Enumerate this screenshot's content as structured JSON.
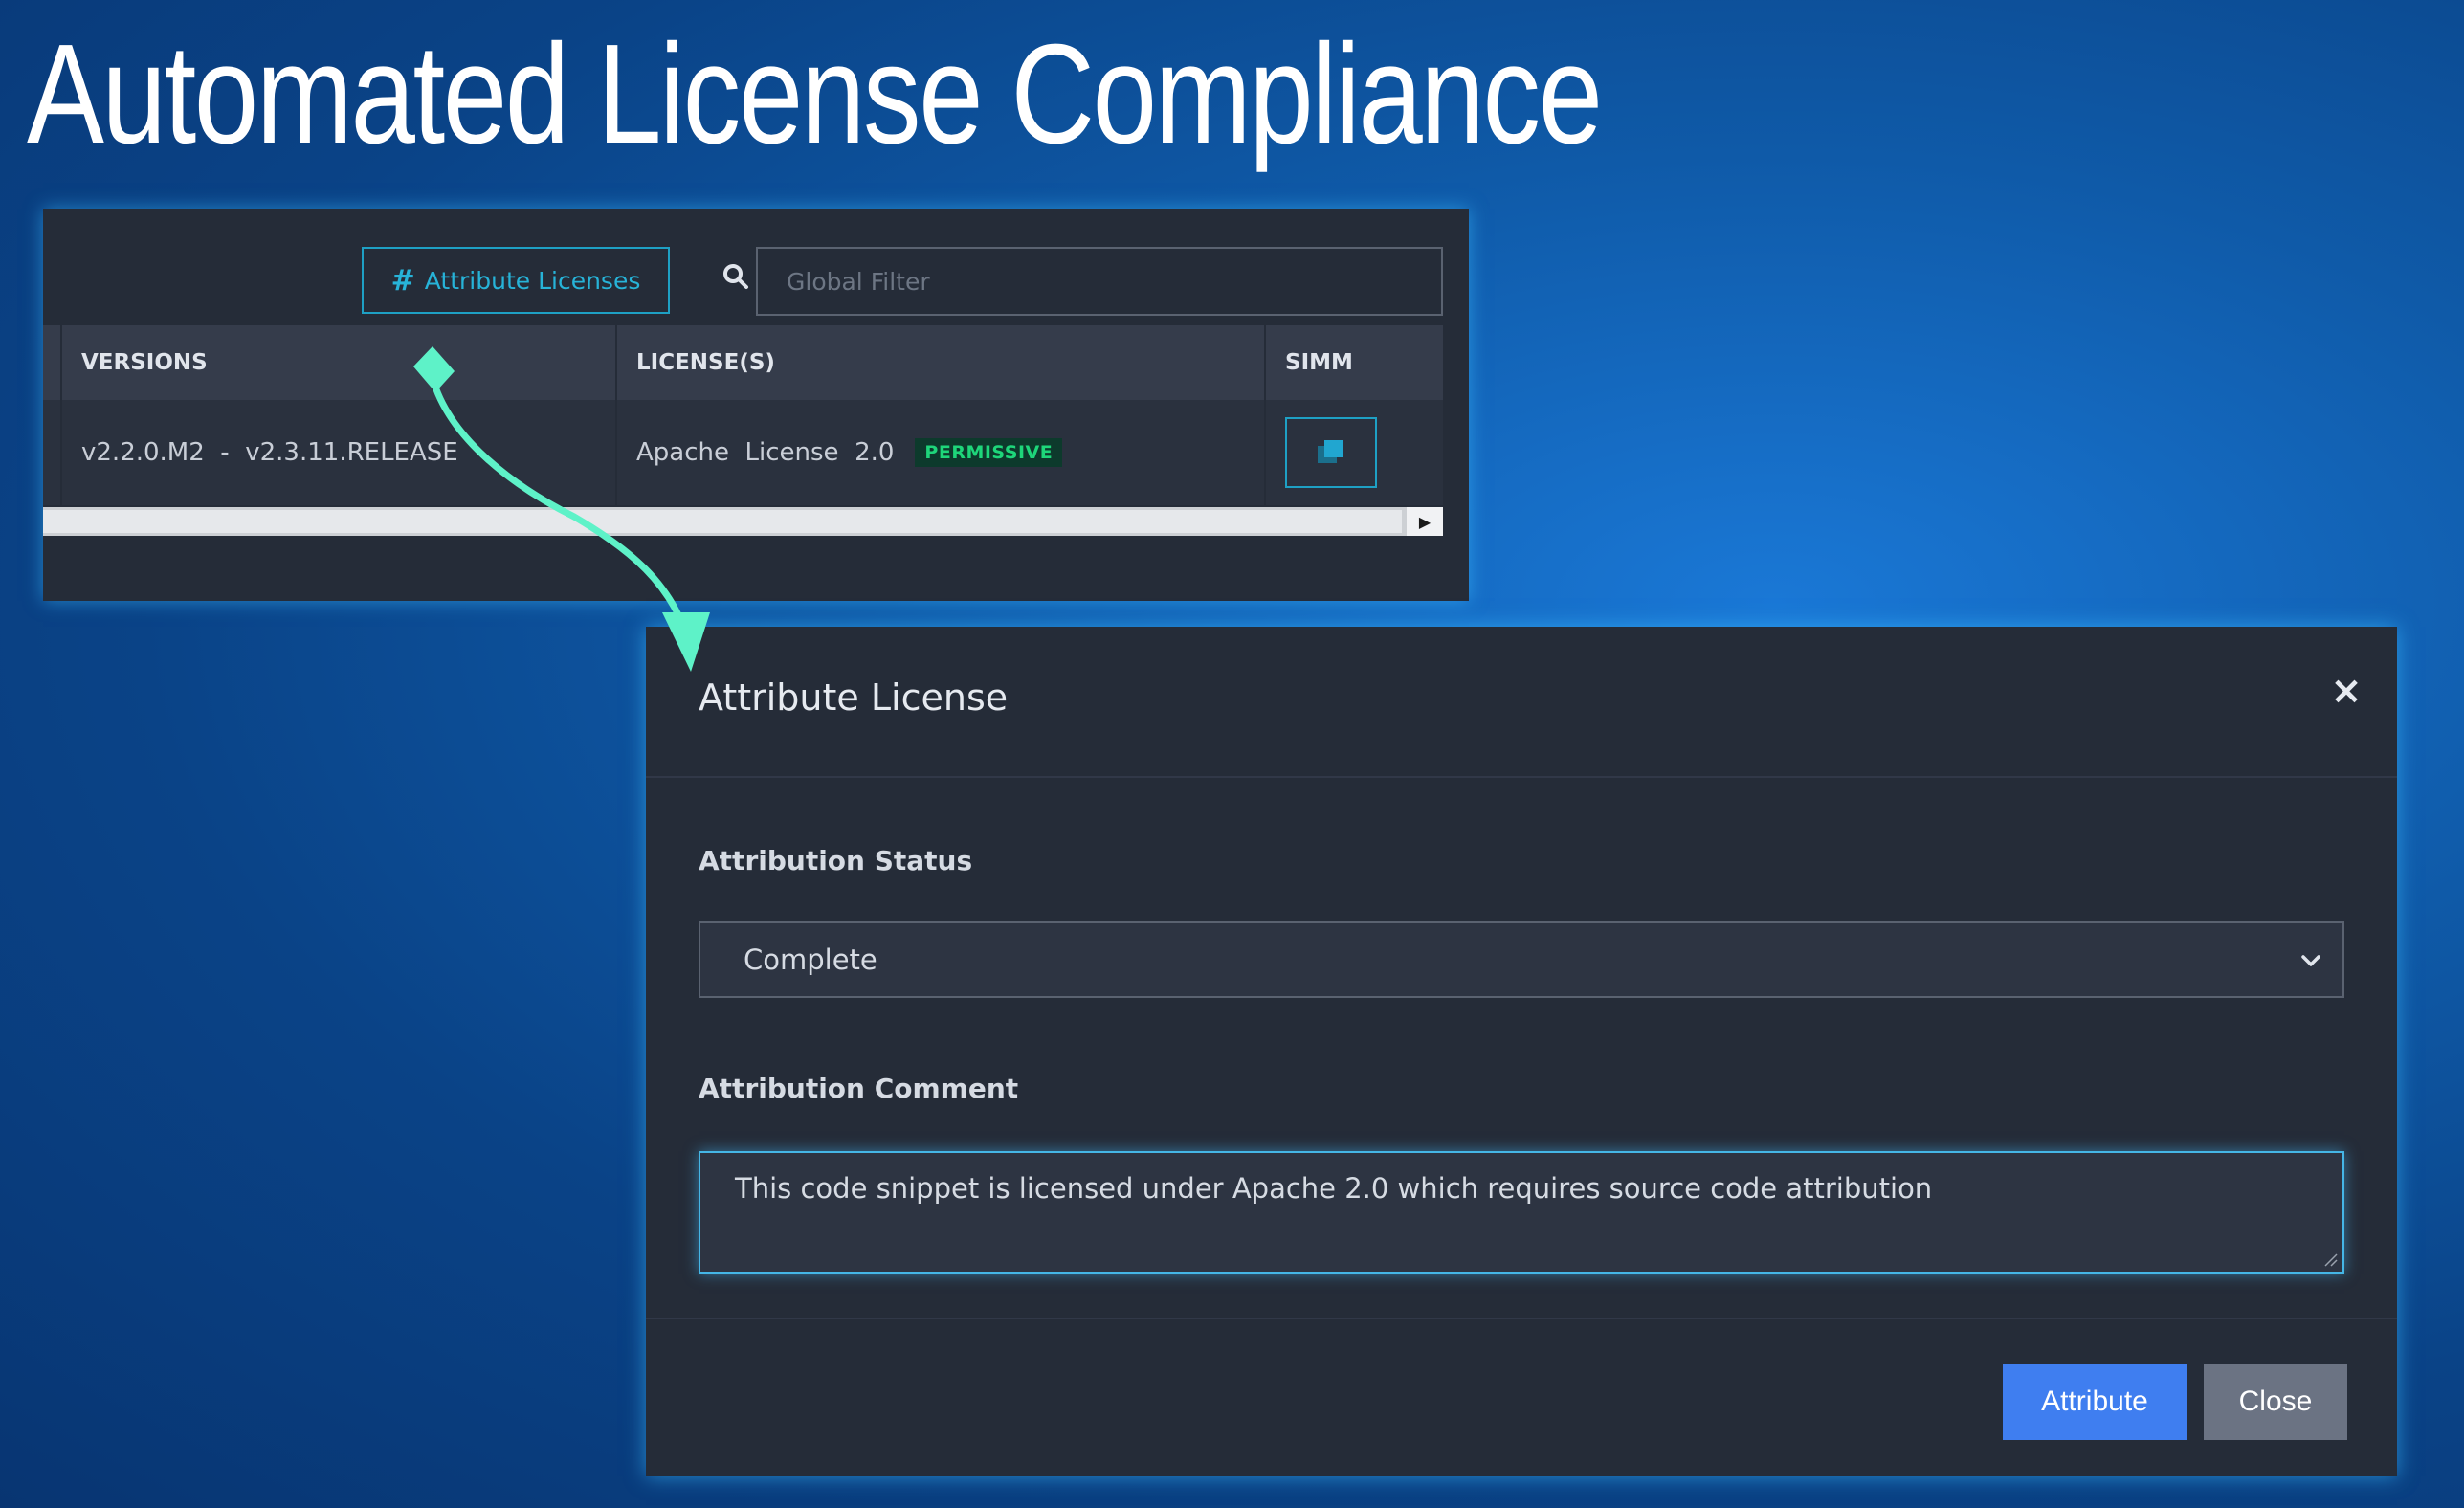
{
  "slide": {
    "title": "Automated License Compliance"
  },
  "toolbar": {
    "attribute_button_icon": "#",
    "attribute_button_label": "Attribute Licenses",
    "search_icon": "search-icon",
    "filter_placeholder": "Global Filter"
  },
  "table": {
    "columns": [
      "VERSIONS",
      "LICENSE(S)",
      "SIMM"
    ],
    "rows": [
      {
        "versions": "v2.2.0.M2  -  v2.3.11.RELEASE",
        "license": "Apache  License  2.0",
        "license_badge": "PERMISSIVE",
        "simm_icon": "copy-icon"
      }
    ]
  },
  "modal": {
    "title": "Attribute License",
    "close_icon": "×",
    "status_label": "Attribution Status",
    "status_value": "Complete",
    "comment_label": "Attribution Comment",
    "comment_value": "This code snippet is licensed under Apache 2.0 which requires source code attribution",
    "attribute_button": "Attribute",
    "close_button": "Close"
  },
  "colors": {
    "accent_teal": "#1ea0c4",
    "badge_green": "#1ed67a",
    "primary_blue": "#3f7ef0",
    "panel_bg": "#252c38",
    "arrow": "#5ef2c8"
  }
}
